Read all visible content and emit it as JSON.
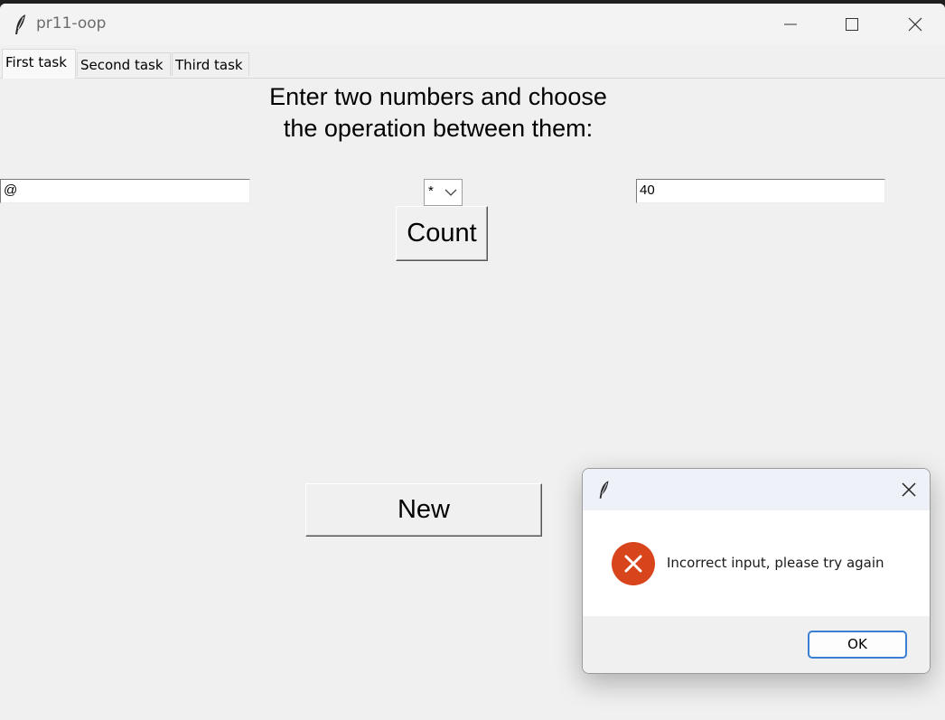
{
  "window": {
    "title": "pr11-oop"
  },
  "tabs": [
    {
      "label": "First task",
      "active": true
    },
    {
      "label": "Second task",
      "active": false
    },
    {
      "label": "Third task",
      "active": false
    }
  ],
  "main": {
    "heading": "Enter two numbers and choose\nthe operation between them:",
    "first_number": "@",
    "operation": "*",
    "second_number": "40",
    "count_label": "Count",
    "new_label": "New"
  },
  "dialog": {
    "message": "Incorrect input, please try again",
    "ok_label": "OK",
    "icon": "error-icon",
    "error_color": "#d8441c",
    "focus_color": "#3b7ed6"
  }
}
